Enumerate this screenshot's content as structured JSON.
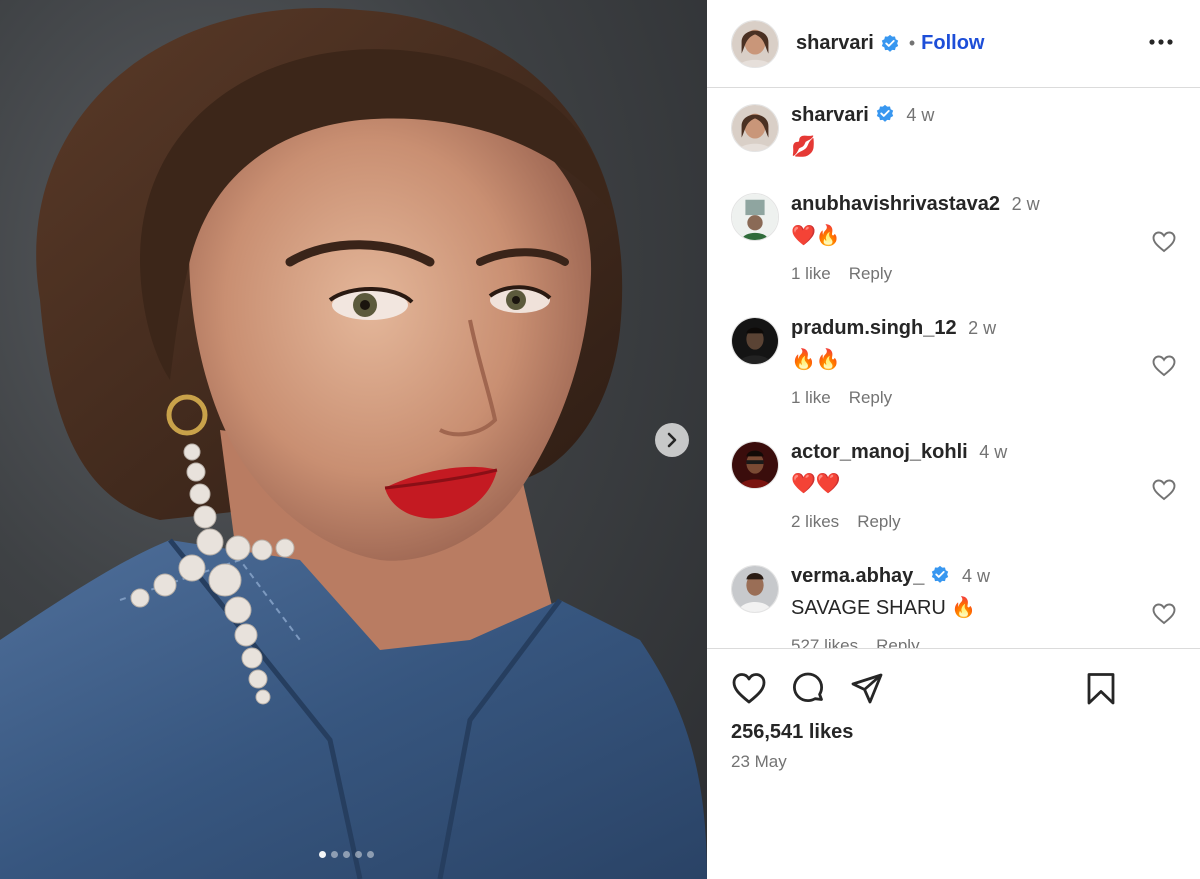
{
  "post": {
    "author": "sharvari",
    "separator": "•",
    "follow_label": "Follow",
    "likes": "256,541 likes",
    "date": "23 May",
    "slide_count": 5,
    "active_slide": 0
  },
  "caption": {
    "user": "sharvari",
    "time": "4 w",
    "text": "💋"
  },
  "comments": [
    {
      "user": "anubhavishrivastava2",
      "time": "2 w",
      "text": "❤️🔥",
      "likes": "1 like",
      "reply": "Reply",
      "verified": false
    },
    {
      "user": "pradum.singh_12",
      "time": "2 w",
      "text": "🔥🔥",
      "likes": "1 like",
      "reply": "Reply",
      "verified": false
    },
    {
      "user": "actor_manoj_kohli",
      "time": "4 w",
      "text": "❤️❤️",
      "likes": "2 likes",
      "reply": "Reply",
      "verified": false
    },
    {
      "user": "verma.abhay_",
      "time": "4 w",
      "text": "SAVAGE SHARU 🔥",
      "likes": "527 likes",
      "reply": "Reply",
      "verified": true
    }
  ],
  "colors": {
    "accent_blue": "#1d4ed8",
    "verified_blue": "#3897f0",
    "text_primary": "#262626",
    "text_secondary": "#737373",
    "divider": "#dbdbdb"
  },
  "icons": [
    "chevron-right-icon",
    "more-options-icon",
    "verified-badge-icon",
    "heart-icon",
    "comment-icon",
    "share-icon",
    "bookmark-icon"
  ]
}
